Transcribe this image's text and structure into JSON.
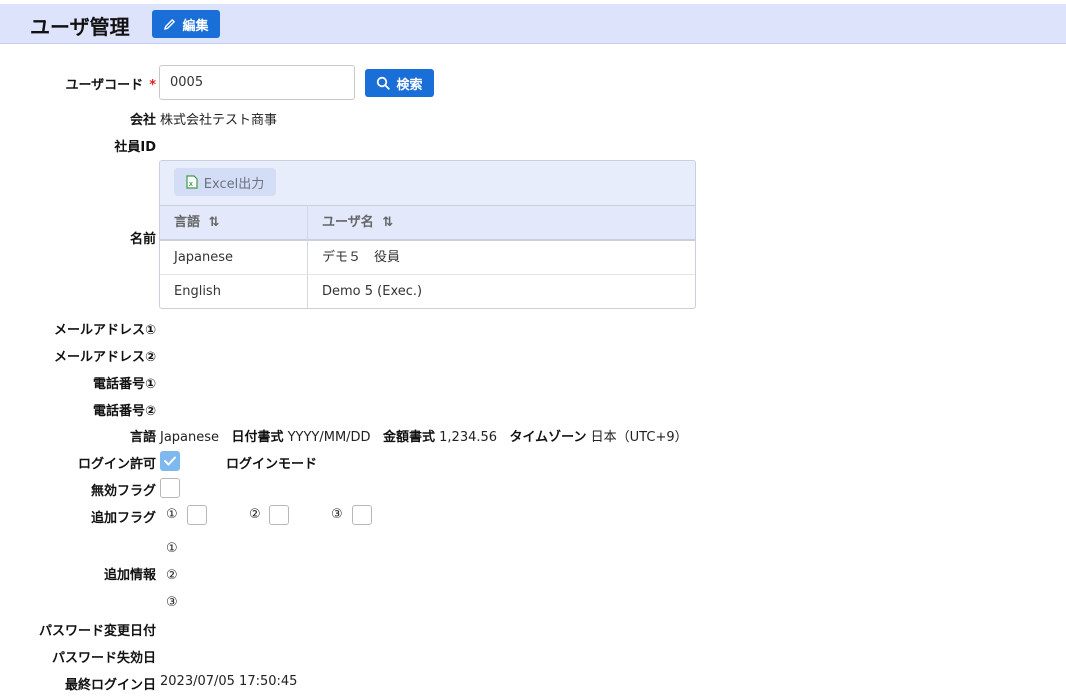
{
  "header": {
    "title": "ユーザ管理",
    "edit_label": "編集"
  },
  "form": {
    "user_code": {
      "label": "ユーザコード",
      "required_mark": "*",
      "value": "0005",
      "search_label": "検索"
    },
    "company": {
      "label": "会社",
      "value": "株式会社テスト商事"
    },
    "employee_id": {
      "label": "社員ID",
      "value": ""
    },
    "name": {
      "label": "名前",
      "excel_label": "Excel出力",
      "columns": [
        "言語",
        "ユーザ名"
      ],
      "rows": [
        {
          "language": "Japanese",
          "user_name": "デモ５　役員"
        },
        {
          "language": "English",
          "user_name": "Demo 5 (Exec.)"
        }
      ]
    },
    "email1": {
      "label": "メールアドレス①"
    },
    "email2": {
      "label": "メールアドレス②"
    },
    "phone1": {
      "label": "電話番号①"
    },
    "phone2": {
      "label": "電話番号②"
    },
    "locale": {
      "label": "言語",
      "language_value": "Japanese",
      "date_format_label": "日付書式",
      "date_format_value": "YYYY/MM/DD",
      "amount_format_label": "金額書式",
      "amount_format_value": "1,234.56",
      "timezone_label": "タイムゾーン",
      "timezone_value": "日本（UTC+9）"
    },
    "login_allowed": {
      "label": "ログイン許可",
      "checked": true,
      "login_mode_label": "ログインモード"
    },
    "invalid_flag": {
      "label": "無効フラグ",
      "checked": false
    },
    "extra_flags": {
      "label": "追加フラグ",
      "items": [
        "①",
        "②",
        "③"
      ]
    },
    "extra_info": {
      "label": "追加情報",
      "items": [
        "①",
        "②",
        "③"
      ]
    },
    "password_changed": {
      "label": "パスワード変更日付"
    },
    "password_expiry": {
      "label": "パスワード失効日"
    },
    "last_login": {
      "label": "最終ログイン日",
      "value": "2023/07/05 17:50:45"
    }
  },
  "colors": {
    "accent": "#1a6ed8",
    "header_bg": "#dde3fb",
    "required": "#e02020"
  }
}
